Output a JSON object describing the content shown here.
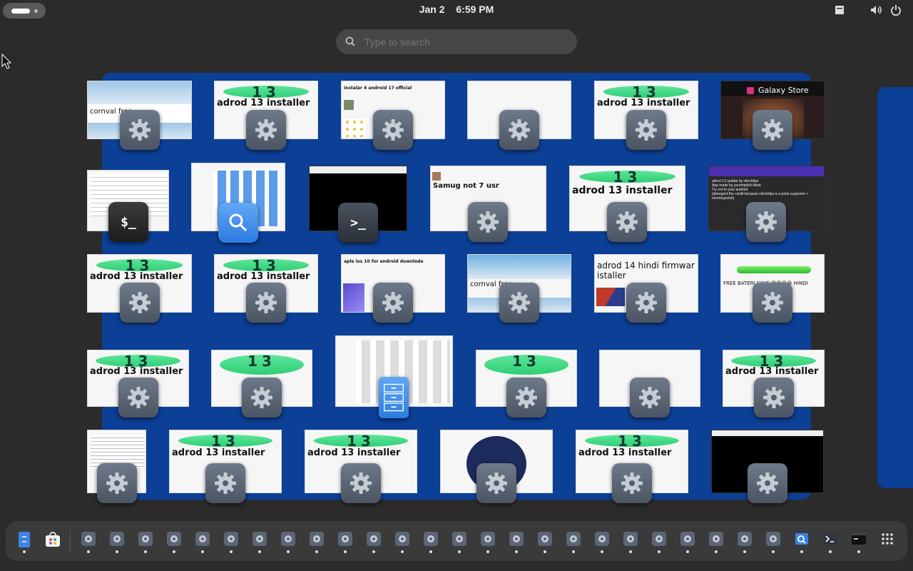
{
  "topbar": {
    "date": "Jan 2",
    "time": "6:59 PM",
    "icons": [
      "activities-indicator",
      "screen-keyboard-icon",
      "volume-icon",
      "power-icon"
    ]
  },
  "search": {
    "placeholder": "Type to search",
    "icon": "search-icon"
  },
  "windows": {
    "w1": {
      "title": "cornval free",
      "kind": "ship"
    },
    "w2": {
      "title": "adrod 13 installer"
    },
    "w3": {
      "title": "instalar 4 android 17 official"
    },
    "w4": {
      "title": ""
    },
    "w5": {
      "title": "adrod 13 installer"
    },
    "w6": {
      "title": "Galaxy Store"
    },
    "w7": {
      "title": "",
      "icon": "terminal-icon"
    },
    "w8": {
      "title": "",
      "icon": "search-icon"
    },
    "w9": {
      "title": "",
      "icon": "terminal-icon"
    },
    "w10": {
      "title": "Samug not 7 usr"
    },
    "w11": {
      "title": "adrod 13 installer"
    },
    "w12": {
      "title": "adrod 13 update by vitechtips",
      "lines": [
        "App made by yourimplicit tiktok",
        "Try not to your android",
        "(disregard the credit because vitechtips is a polar supporter + morningsclub)"
      ]
    },
    "w13": {
      "title": "adrod 13 installer"
    },
    "w14": {
      "title": "adrod 13 installer"
    },
    "w15": {
      "title": "aple ios 10 for android downlode"
    },
    "w16": {
      "title": "cornval free"
    },
    "w17": {
      "title": "adrod 14 hindi firmwar istaller"
    },
    "w18": {
      "title": "FREE BATERI SAVE 😀😀😀😀 HINDI"
    },
    "w19": {
      "title": "adrod 13 installer"
    },
    "w20": {
      "title": ""
    },
    "w21": {
      "title": "",
      "icon": "file-cabinet-icon"
    },
    "w22": {
      "title": ""
    },
    "w23": {
      "title": ""
    },
    "w24": {
      "title": "adrod 13 installer"
    },
    "w25": {
      "title": ""
    },
    "w26": {
      "title": "adrod 13 installer"
    },
    "w27": {
      "title": "adrod 13 installer"
    },
    "w28": {
      "title": ""
    },
    "w29": {
      "title": "adrod 13 installer"
    },
    "w30": {
      "title": ""
    }
  },
  "dock": {
    "pinned": [
      "file-manager-icon",
      "software-store-icon"
    ],
    "running_generic_count": 25,
    "running_extra": [
      "search-app-icon",
      "terminal-icon",
      "terminal-dark-icon"
    ],
    "app_grid": "app-grid-icon"
  },
  "colors": {
    "workspace": "#0c3f96",
    "background": "#2b2b2b",
    "dock": "#3a3a3a",
    "banner": "#3fd884"
  }
}
